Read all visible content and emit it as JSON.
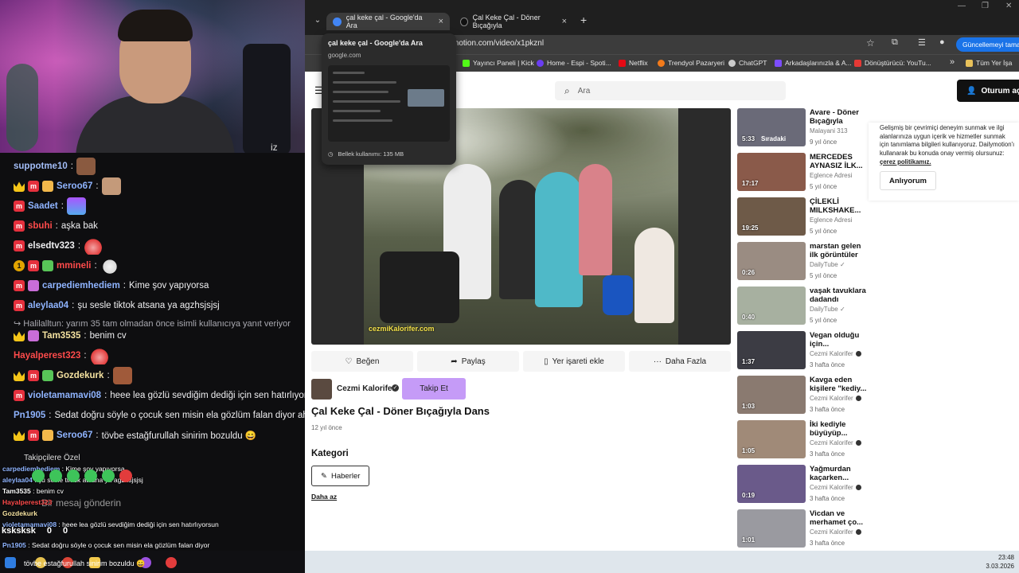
{
  "webcam_side_text": "iz",
  "chat": {
    "messages": [
      {
        "user": "suppotme10",
        "text": "",
        "color": "#a3bdf7"
      },
      {
        "user": "Seroo67",
        "text": "",
        "color": "#8fb4ff"
      },
      {
        "user": "Saadet",
        "text": "",
        "color": "#8fb4ff"
      },
      {
        "user": "sbuhi",
        "text": "aşka bak",
        "color": "#ff4b4b"
      },
      {
        "user": "elsedtv323",
        "text": "",
        "color": "#efeff1"
      },
      {
        "user": "mmineli",
        "text": "",
        "color": "#ff4b4b"
      },
      {
        "user": "carpediemhediem",
        "text": "Kime şov yapıyorsa",
        "color": "#8fb4ff"
      },
      {
        "user": "aleylaa04",
        "text": "şu sesle tiktok atsana ya agzhsjsjsj",
        "color": "#8fb4ff"
      },
      {
        "user": "Tam3535",
        "text": "benim cv",
        "color": "#f5e2a0"
      },
      {
        "user": "Hayalperest323",
        "text": "",
        "color": "#ff4b4b"
      },
      {
        "user": "Gozdekurk",
        "text": "",
        "color": "#f5e2a0"
      },
      {
        "user": "violetamamavi08",
        "text": "heee lea gözlü sevdiğim dediği için sen hatırlıyorsun",
        "color": "#8fb4ff"
      },
      {
        "user": "Pn1905",
        "text": "Sedat doğru söyle o çocuk sen misin ela gözlüm falan diyor ahaha",
        "color": "#8fb4ff"
      },
      {
        "user": "Seroo67",
        "text": "tövbe estağfurullah sinirim bozuldu 😄",
        "color": "#8fb4ff"
      }
    ],
    "reply_notice": "Halilalltun: yarım 35 tam olmadan önce isimli kullanıcıya yanıt veriyor",
    "badge_gold_label": "1",
    "badge_mod_label": "m"
  },
  "overlay_chat": {
    "header": "Takipçilere Özel",
    "placeholder": "Bir mesaj gönderin",
    "counters": [
      "0",
      "0"
    ],
    "lines": [
      {
        "user": "carpediemhediem",
        "text": "Kime şov yapıyorsa"
      },
      {
        "user": "aleylaa04",
        "text": "şu sesle tiktok atsana ya agzhsjsjsj"
      },
      {
        "user": "Tam3535",
        "text": "benim cv"
      },
      {
        "user": "Hayalperest323",
        "text": ""
      },
      {
        "user": "Gozdekurk",
        "text": ""
      },
      {
        "user": "violetamamavi08",
        "text": "heee lea gözlü sevdiğim dediği için sen hatırlıyorsun"
      },
      {
        "user": "Pn1905",
        "text": "Sedat doğru söyle o çocuk sen misin ela gözlüm falan diyor"
      }
    ],
    "chat_label": "ksksksk",
    "ticker": "tövbe estağfurullah sinirim bozuldu 😄"
  },
  "browser": {
    "tabs": [
      {
        "title": "çal keke çal - Google'da Ara",
        "icon_color": "#4285f4"
      },
      {
        "title": "Çal Keke Çal - Döner Bıçağıyla",
        "icon_color": "#111111"
      }
    ],
    "url": "motion.com/video/x1pkznl",
    "update_label": "Güncellemeyi tamamla",
    "bookmarks": [
      {
        "label": "Yayıncı Paneli | Kick",
        "color": "#53fc18"
      },
      {
        "label": "Home - Espi - Spoti...",
        "color": "#6a3df2"
      },
      {
        "label": "Netflix",
        "color": "#e50914"
      },
      {
        "label": "Trendyol Pazaryeri",
        "color": "#f27a1a"
      },
      {
        "label": "ChatGPT",
        "color": "#cccccc"
      },
      {
        "label": "Arkadaşlarınızla & A...",
        "color": "#7c4dff"
      },
      {
        "label": "Dönüştürücü: YouTu...",
        "color": "#e53935"
      }
    ],
    "bookmarks_all": "Tüm Yer İşa",
    "hover_card": {
      "title": "çal keke çal - Google'da Ara",
      "domain": "google.com",
      "memory": "Bellek kullanımı: 135 MB"
    }
  },
  "page": {
    "search_placeholder": "Ara",
    "login_label": "Oturum açın",
    "video_watermark": "cezmiKalorifer.com",
    "actions": [
      "Beğen",
      "Paylaş",
      "Yer işareti ekle",
      "Daha Fazla"
    ],
    "channel_name": "Cezmi Kalorifer",
    "follow_label": "Takip Et",
    "video_title": "Çal Keke Çal - Döner Bıçağıyla Dans",
    "video_age": "12 yıl önce",
    "category_title": "Kategori",
    "category_chip": "Haberler",
    "less_link": "Daha az",
    "related": [
      {
        "duration": "5:33",
        "tag": "Sıradaki",
        "title": "Avare - Döner Bıçağıyla Dans...",
        "channel": "Malayani 313",
        "age": "9 yıl önce",
        "verified": false,
        "thumb": "#6a6a78"
      },
      {
        "duration": "17:17",
        "tag": "",
        "title": "MERCEDES AYNASIZ İLK...",
        "channel": "Eglence Adresi",
        "age": "5 yıl önce",
        "verified": false,
        "thumb": "#8a5a4a"
      },
      {
        "duration": "19:25",
        "tag": "",
        "title": "ÇİLEKLİ MILKSHAKE...",
        "channel": "Eglence Adresi",
        "age": "5 yıl önce",
        "verified": false,
        "thumb": "#6e5a48"
      },
      {
        "duration": "0:26",
        "tag": "",
        "title": "marstan gelen ilk görüntüler",
        "channel": "DailyTube ✓",
        "age": "5 yıl önce",
        "verified": false,
        "thumb": "#9a8c82"
      },
      {
        "duration": "0:40",
        "tag": "",
        "title": "vaşak tavuklara dadandı",
        "channel": "DailyTube ✓",
        "age": "5 yıl önce",
        "verified": false,
        "thumb": "#a7b0a0"
      },
      {
        "duration": "1:37",
        "tag": "",
        "title": "Vegan olduğu için...",
        "channel": "Cezmi Kalorifer",
        "age": "3 hafta önce",
        "verified": true,
        "thumb": "#3c3c44"
      },
      {
        "duration": "1:03",
        "tag": "",
        "title": "Kavga eden kişilere \"kediy...",
        "channel": "Cezmi Kalorifer",
        "age": "3 hafta önce",
        "verified": true,
        "thumb": "#8a7a70"
      },
      {
        "duration": "1:05",
        "tag": "",
        "title": "İki kediyle büyüyüp...",
        "channel": "Cezmi Kalorifer",
        "age": "3 hafta önce",
        "verified": true,
        "thumb": "#a08a78"
      },
      {
        "duration": "0:19",
        "tag": "",
        "title": "Yağmurdan kaçarken...",
        "channel": "Cezmi Kalorifer",
        "age": "3 hafta önce",
        "verified": true,
        "thumb": "#6a5a8a"
      },
      {
        "duration": "1:01",
        "tag": "",
        "title": "Vicdan ve merhamet ço...",
        "channel": "Cezmi Kalorifer",
        "age": "3 hafta önce",
        "verified": true,
        "thumb": "#9a9aa0"
      }
    ],
    "cookie": {
      "text": "Gelişmiş bir çevrimiçi deneyim sunmak ve ilgi alanlarınıza uygun içerik ve hizmetler sunmak için tanımlama bilgileri kullanıyoruz. Dailymotion'ı kullanarak bu konuda onay vermiş olursunuz: ",
      "link": "çerez politikamız.",
      "button": "Anlıyorum"
    }
  },
  "taskbar": {
    "time": "23:48",
    "date": "3.03.2026"
  }
}
